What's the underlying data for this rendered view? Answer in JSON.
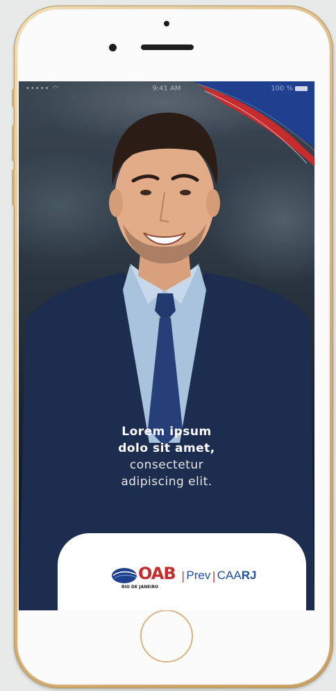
{
  "status_bar": {
    "signal": "•••••",
    "time": "9:41 AM",
    "battery": "100 %"
  },
  "tagline": {
    "line1": "Lorem ipsum",
    "line2": "dolo sit amet,",
    "line3": "consectetur",
    "line4": "adipiscing elit."
  },
  "logo": {
    "oab": "OAB",
    "region": "RIO DE JANEIRO",
    "divider": "|",
    "prev": "Prev",
    "caa": "CAA",
    "rj": "RJ"
  },
  "colors": {
    "brand_blue": "#1f4fa0",
    "brand_red": "#c62b2e",
    "frame_gold": "#d9b680"
  },
  "icons": [
    "wifi-icon",
    "battery-icon",
    "oab-globe-icon"
  ]
}
